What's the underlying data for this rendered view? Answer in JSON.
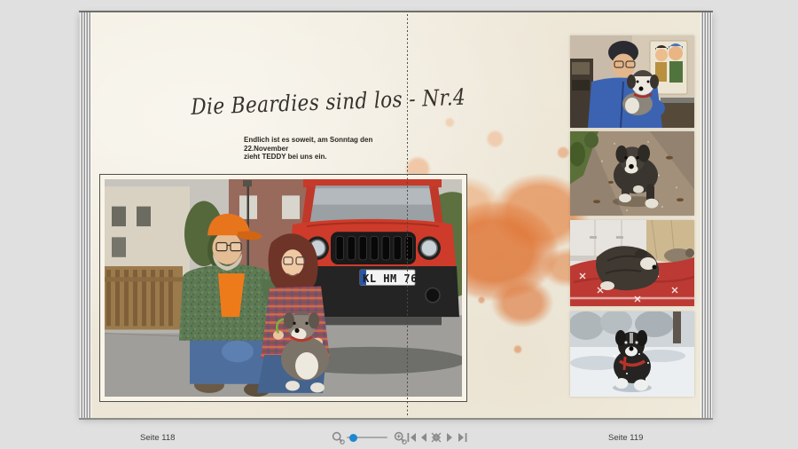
{
  "statusbar": {
    "left_page_label": "Seite 118",
    "right_page_label": "Seite 119"
  },
  "controls": {
    "zoom_out_icon": "magnifier-minus",
    "zoom_in_icon": "magnifier-plus",
    "slider_position_pct": 12,
    "slider_handle_color": "#1d87cf",
    "first_page_icon": "first-page",
    "previous_page_icon": "previous-page",
    "fit_page_icon": "fit-to-window",
    "next_page_icon": "next-page",
    "last_page_icon": "last-page"
  },
  "spread": {
    "page_color": "#f3eee1",
    "fold_style": "dashed-line",
    "left_page": {
      "title": "Die Beardies sind los - Nr.4",
      "subtitle_line1": "Endlich ist es soweit, am Sonntag den 22.November",
      "subtitle_line2": "zieht TEDDY bei uns ein.",
      "watercolor_accent_color": "#df783a",
      "main_photo": {
        "name": "couple-with-puppy-and-red-jeep",
        "license_plate": "KL HM 76"
      }
    },
    "right_page": {
      "photos": [
        {
          "name": "man-holding-puppy-indoors"
        },
        {
          "name": "puppy-walking-on-gravel-path"
        },
        {
          "name": "puppy-sleeping-on-red-cushion"
        },
        {
          "name": "dog-running-in-snow"
        }
      ]
    }
  }
}
